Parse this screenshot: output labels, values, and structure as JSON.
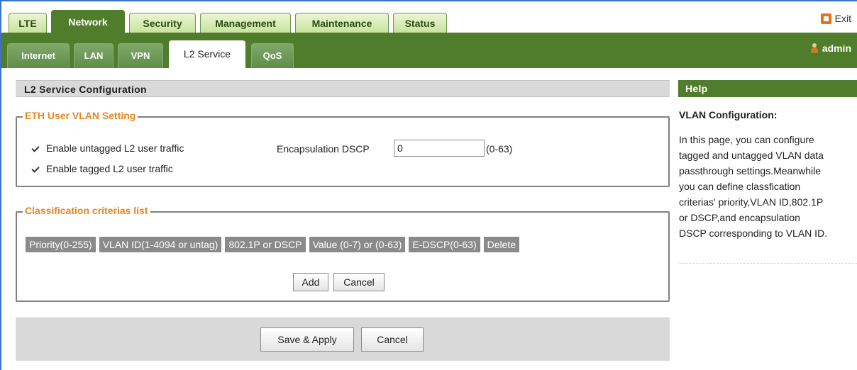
{
  "top_tabs": [
    "LTE",
    "Network",
    "Security",
    "Management",
    "Maintenance",
    "Status"
  ],
  "active_top_tab": "Network",
  "exit_label": "Exit",
  "sub_tabs": [
    "Internet",
    "LAN",
    "VPN",
    "L2 Service",
    "QoS"
  ],
  "active_sub_tab": "L2 Service",
  "user_label": "admin",
  "section_title": "L2 Service Configuration",
  "eth_vlan": {
    "legend": "ETH User VLAN Setting",
    "untagged_label": "Enable untagged L2 user traffic",
    "untagged_checked": true,
    "tagged_label": "Enable tagged L2 user traffic",
    "tagged_checked": true,
    "dscp_label": "Encapsulation DSCP",
    "dscp_value": "0",
    "dscp_range": "(0-63)"
  },
  "classification": {
    "legend": "Classification criterias list",
    "columns": [
      "Priority(0-255)",
      "VLAN ID(1-4094 or untag)",
      "802.1P or DSCP",
      "Value (0-7) or (0-63)",
      "E-DSCP(0-63)",
      "Delete"
    ],
    "add_label": "Add",
    "cancel_label": "Cancel"
  },
  "footer": {
    "save_label": "Save & Apply",
    "cancel_label": "Cancel"
  },
  "help": {
    "header": "Help",
    "title": "VLAN Configuration:",
    "lines": [
      "In this page, you can configure",
      "tagged and untagged VLAN data",
      "passthrough settings.Meanwhile",
      "you can define classfication",
      "criterias' priority,VLAN ID,802.1P",
      "or DSCP,and encapsulation",
      "DSCP corresponding to VLAN ID."
    ]
  },
  "colors": {
    "accent_green": "#4f7d2b",
    "legend_orange": "#e8851e",
    "frame_blue": "#3b73c8"
  }
}
